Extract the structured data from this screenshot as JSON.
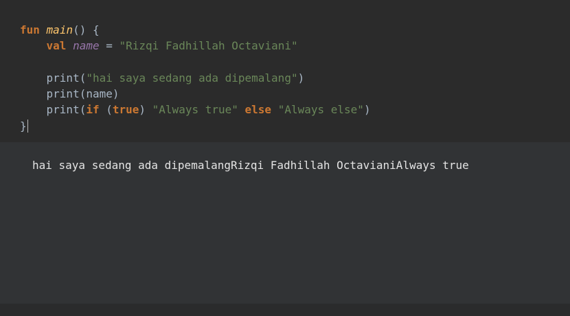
{
  "editor": {
    "lines": [
      [
        {
          "t": "fun",
          "c": "kw"
        },
        {
          "t": " ",
          "c": "plain"
        },
        {
          "t": "main",
          "c": "fn"
        },
        {
          "t": "() {",
          "c": "plain"
        }
      ],
      [
        {
          "t": "    ",
          "c": "plain"
        },
        {
          "t": "val",
          "c": "kw"
        },
        {
          "t": " ",
          "c": "plain"
        },
        {
          "t": "name",
          "c": "var"
        },
        {
          "t": " = ",
          "c": "plain"
        },
        {
          "t": "\"Rizqi Fadhillah Octaviani\"",
          "c": "str"
        }
      ],
      [],
      [
        {
          "t": "    print(",
          "c": "plain"
        },
        {
          "t": "\"hai saya sedang ada dipemalang\"",
          "c": "str"
        },
        {
          "t": ")",
          "c": "plain"
        }
      ],
      [
        {
          "t": "    print(name)",
          "c": "plain"
        }
      ],
      [
        {
          "t": "    print(",
          "c": "plain"
        },
        {
          "t": "if",
          "c": "kw"
        },
        {
          "t": " (",
          "c": "plain"
        },
        {
          "t": "true",
          "c": "kw"
        },
        {
          "t": ") ",
          "c": "plain"
        },
        {
          "t": "\"Always true\"",
          "c": "str"
        },
        {
          "t": " ",
          "c": "plain"
        },
        {
          "t": "else",
          "c": "kw"
        },
        {
          "t": " ",
          "c": "plain"
        },
        {
          "t": "\"Always else\"",
          "c": "str"
        },
        {
          "t": ")",
          "c": "plain"
        }
      ],
      [
        {
          "t": "}",
          "c": "plain"
        }
      ]
    ],
    "cursor_line": 6
  },
  "output": {
    "text": "hai saya sedang ada dipemalangRizqi Fadhillah OctavianiAlways true"
  },
  "colors": {
    "keyword": "#cc7832",
    "function": "#ffc66d",
    "variable": "#9876aa",
    "string": "#6a8759",
    "plain": "#a9b7c6",
    "editor_bg": "#2b2b2b",
    "output_bg": "#313335"
  }
}
